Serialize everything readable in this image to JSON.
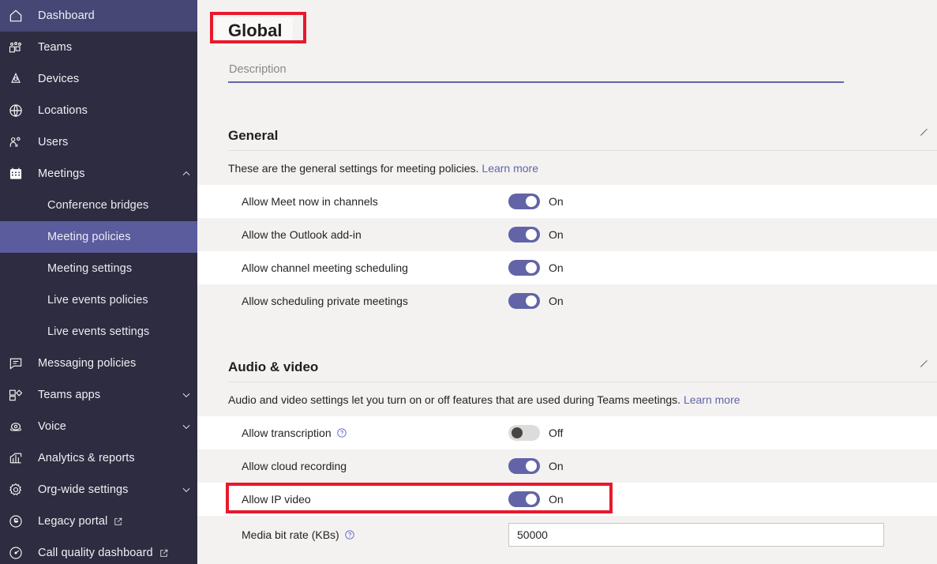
{
  "sidebar": {
    "items": [
      {
        "label": "Dashboard",
        "icon": "home-icon",
        "state": "active",
        "level": "top"
      },
      {
        "label": "Teams",
        "icon": "teams-icon",
        "state": "",
        "level": "top"
      },
      {
        "label": "Devices",
        "icon": "devices-icon",
        "state": "",
        "level": "top"
      },
      {
        "label": "Locations",
        "icon": "globe-icon",
        "state": "",
        "level": "top"
      },
      {
        "label": "Users",
        "icon": "users-icon",
        "state": "",
        "level": "top"
      },
      {
        "label": "Meetings",
        "icon": "calendar-icon",
        "state": "expanded",
        "level": "top",
        "chevron": "chevron-up-icon"
      },
      {
        "label": "Conference bridges",
        "icon": "",
        "state": "",
        "level": "sub"
      },
      {
        "label": "Meeting policies",
        "icon": "",
        "state": "selected",
        "level": "sub"
      },
      {
        "label": "Meeting settings",
        "icon": "",
        "state": "",
        "level": "sub"
      },
      {
        "label": "Live events policies",
        "icon": "",
        "state": "",
        "level": "sub"
      },
      {
        "label": "Live events settings",
        "icon": "",
        "state": "",
        "level": "sub"
      },
      {
        "label": "Messaging policies",
        "icon": "message-icon",
        "state": "",
        "level": "top"
      },
      {
        "label": "Teams apps",
        "icon": "apps-icon",
        "state": "",
        "level": "top",
        "chevron": "chevron-down-icon"
      },
      {
        "label": "Voice",
        "icon": "phone-icon",
        "state": "",
        "level": "top",
        "chevron": "chevron-down-icon"
      },
      {
        "label": "Analytics & reports",
        "icon": "chart-icon",
        "state": "",
        "level": "top"
      },
      {
        "label": "Org-wide settings",
        "icon": "gear-icon",
        "state": "",
        "level": "top",
        "chevron": "chevron-down-icon"
      },
      {
        "label": "Legacy portal",
        "icon": "skype-icon",
        "state": "",
        "level": "top",
        "external": "external-link-icon"
      },
      {
        "label": "Call quality dashboard",
        "icon": "gauge-icon",
        "state": "",
        "level": "top",
        "external": "external-link-icon"
      }
    ]
  },
  "page": {
    "title": "Global",
    "description_value": "",
    "description_placeholder": "Description"
  },
  "sections": [
    {
      "title": "General",
      "description": "These are the general settings for meeting policies.",
      "learn_more": "Learn more",
      "rows": [
        {
          "label": "Allow Meet now in channels",
          "control": "toggle",
          "value": "On",
          "state": "on"
        },
        {
          "label": "Allow the Outlook add-in",
          "control": "toggle",
          "value": "On",
          "state": "on"
        },
        {
          "label": "Allow channel meeting scheduling",
          "control": "toggle",
          "value": "On",
          "state": "on"
        },
        {
          "label": "Allow scheduling private meetings",
          "control": "toggle",
          "value": "On",
          "state": "on"
        }
      ]
    },
    {
      "title": "Audio & video",
      "description": "Audio and video settings let you turn on or off features that are used during Teams meetings.",
      "learn_more": "Learn more",
      "rows": [
        {
          "label": "Allow transcription",
          "control": "toggle",
          "value": "Off",
          "state": "off",
          "info": "help-icon"
        },
        {
          "label": "Allow cloud recording",
          "control": "toggle",
          "value": "On",
          "state": "on"
        },
        {
          "label": "Allow IP video",
          "control": "toggle",
          "value": "On",
          "state": "on",
          "highlighted": true
        },
        {
          "label": "Media bit rate (KBs)",
          "control": "input",
          "value": "50000",
          "info": "help-icon"
        }
      ]
    }
  ],
  "colors": {
    "sidebar_bg": "#2d2c40",
    "sidebar_active": "#464775",
    "sidebar_selected": "#5b5c9d",
    "accent": "#6264a7",
    "highlight": "#e8192c",
    "page_bg": "#f3f2f1",
    "row_bg": "#ffffff"
  }
}
